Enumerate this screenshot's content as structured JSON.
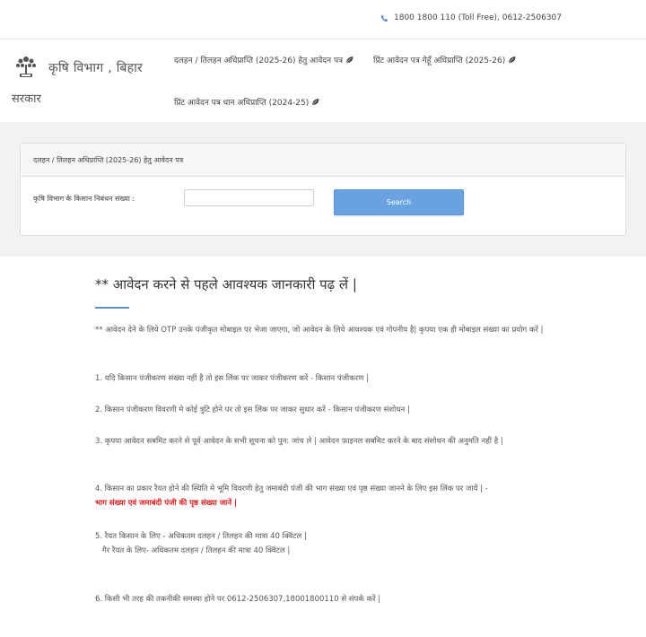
{
  "topbar": {
    "contact": "1800 1800 110 (Toll Free), 0612-2506307"
  },
  "header": {
    "brand_line1": "कृषि विभाग , बिहार",
    "brand_line2": "सरकार",
    "nav": [
      {
        "label": "दलहन / तिलहन अधिप्राप्ति (2025-26) हेतु आवेदन पत्र"
      },
      {
        "label": "प्रिंट आवेदन पत्र गेहूँ अधिप्राप्ति (2025-26)"
      },
      {
        "label": "प्रिंट आवेदन पत्र धान अधिप्राप्ति (2024-25)"
      }
    ]
  },
  "panel": {
    "title": "दलहन / तिलहन अधिप्राप्ति (2025-26) हेतु आवेदन पत्र",
    "field_label": "कृषि विभाग के किसान निबंधन संख्या :",
    "field_value": "",
    "button_label": "Search"
  },
  "info": {
    "heading": "** आवेदन करने से पहले आवश्यक जानकारी पढ़ लें |",
    "intro": "** आवेदन देने के लिये OTP उनके पंजीकृत मोबाइल पर भेजा जाएगा, जो आवेदन के लिये आवश्यक एवं गोपनीय है| कृपया एक ही मोबाइल संख्या का प्रयोग करें |",
    "point1": "1. यदि किसान पंजीकरण संख्या नहीं है तो इस लिंक पर जाकर पंजीकरण करें - किसान पंजीकरण |",
    "point2": "2. किसान पंजीकरण विवरणी मे कोई त्रुटि होने पर तो इस लिंक पर जाकर सुधार करें - किसान पंजीकरण संशोधन |",
    "point3": "3. कृपया आवेदन सबमिट करने से पूर्व आवेदन के सभी सूचना को पुन: जांच ले | आवेदन फ़ाइनल सबमिट करने के बाद संसोधन की अनुमति नहीं है |",
    "point4": "4. किसान का प्रकार रैयत होने की स्थिति मे भूमि विवरणी हेतु जमाबंदी पंजी की भाग संख्या एवं पृष्ठ संख्या जानने के लिए इस लिंक पर जायें | -",
    "point4_link": "भाग संख्या एवं जमाबंदी पंजी की पृष्ठ संख्या जानें |",
    "point5a": "5. रैयत किसान के लिए - अधिकतम दलहन / तिलहन की मात्रा 40 क्विंटल |",
    "point5b": "गैर रैयत के लिए- अधिकतम दलहन / तिलहन की मात्रा 40 क्विंटल |",
    "point6": "6. किसी भी तरह की तकनीकी समस्या होने पर 0612-2506307,18001800110 से संपर्क करें |"
  },
  "colors": {
    "accent": "#6aa2e0",
    "link_red": "#d22222",
    "panel_band": "#f2f2f2"
  }
}
